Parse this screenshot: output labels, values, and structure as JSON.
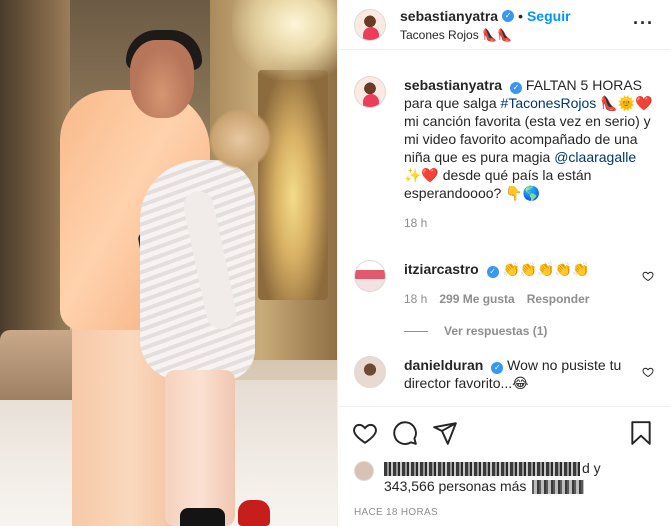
{
  "post": {
    "username": "sebastianyatra",
    "follow_label": "Seguir",
    "location": "Tacones Rojos 👠👠",
    "more_icon": "more-horizontal-icon"
  },
  "caption": {
    "username": "sebastianyatra",
    "text_before_tag": "FALTAN 5 HORAS para que salga ",
    "hashtag": "#TaconesRojos",
    "text_mid": " 👠🌞❤️ mi canción favorita (esta vez en serio) y mi video favorito acompañado de una niña que es pura magia ",
    "mention": "@claaragalle",
    "text_after": " ✨❤️ desde qué país la están esperandoooo? 👇🌎",
    "time": "18 h"
  },
  "comments": [
    {
      "username": "itziarcastro",
      "text": "👏👏👏👏👏",
      "time": "18 h",
      "likes": "299 Me gusta",
      "reply_label": "Responder",
      "view_replies": "Ver respuestas (1)"
    },
    {
      "username": "danielduran",
      "text": "Wow no pusiste tu director favorito...😂"
    }
  ],
  "actions": {
    "like_icon": "heart-icon",
    "comment_icon": "comment-icon",
    "share_icon": "share-icon",
    "save_icon": "bookmark-icon"
  },
  "likes": {
    "text_end": "d y",
    "text_line2": "343,566 personas más"
  },
  "timestamp": "HACE 18 HORAS",
  "colors": {
    "accent": "#0095f6",
    "verified": "#3897f0",
    "link": "#00376b",
    "muted": "#8e8e8e"
  }
}
